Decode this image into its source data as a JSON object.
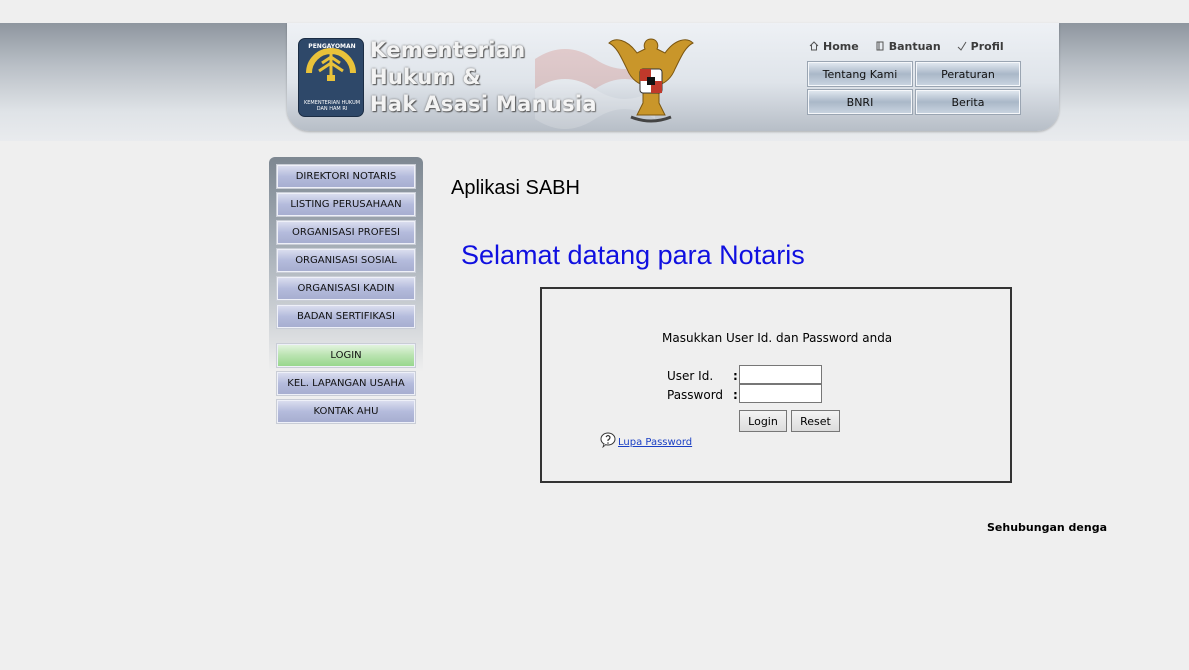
{
  "header": {
    "logo_caption_top": "PENGAYOMAN",
    "logo_caption_bottom": "KEMENTERIAN HUKUM DAN HAM RI",
    "title_line1": "Kementerian",
    "title_line2": "Hukum &",
    "title_line3": "Hak Asasi Manusia",
    "top_links": [
      {
        "label": "Home",
        "icon": "home-icon"
      },
      {
        "label": "Bantuan",
        "icon": "help-book-icon"
      },
      {
        "label": "Profil",
        "icon": "check-icon"
      }
    ],
    "nav_buttons": [
      "Tentang Kami",
      "Peraturan",
      "BNRI",
      "Berita"
    ]
  },
  "sidebar": {
    "items": [
      "DIREKTORI NOTARIS",
      "LISTING PERUSAHAAN",
      "ORGANISASI PROFESI",
      "ORGANISASI SOSIAL",
      "ORGANISASI KADIN",
      "BADAN SERTIFIKASI"
    ],
    "login": "LOGIN",
    "items2": [
      "KEL. LAPANGAN USAHA",
      "KONTAK AHU"
    ]
  },
  "main": {
    "app_title": "Aplikasi SABH",
    "welcome": "Selamat datang para Notaris",
    "login_form": {
      "instruction": "Masukkan User Id. dan Password anda",
      "user_label": "User Id.",
      "password_label": "Password",
      "colon": ":",
      "user_value": "",
      "password_value": "",
      "login_button": "Login",
      "reset_button": "Reset",
      "forgot_link": "Lupa Password"
    },
    "marquee_text": "Sehubungan dengan a"
  },
  "colors": {
    "welcome": "#1010e0",
    "link": "#1a3fc4",
    "menu_button": "#b4bbdc",
    "login_menu_button": "#b9e3b0"
  }
}
